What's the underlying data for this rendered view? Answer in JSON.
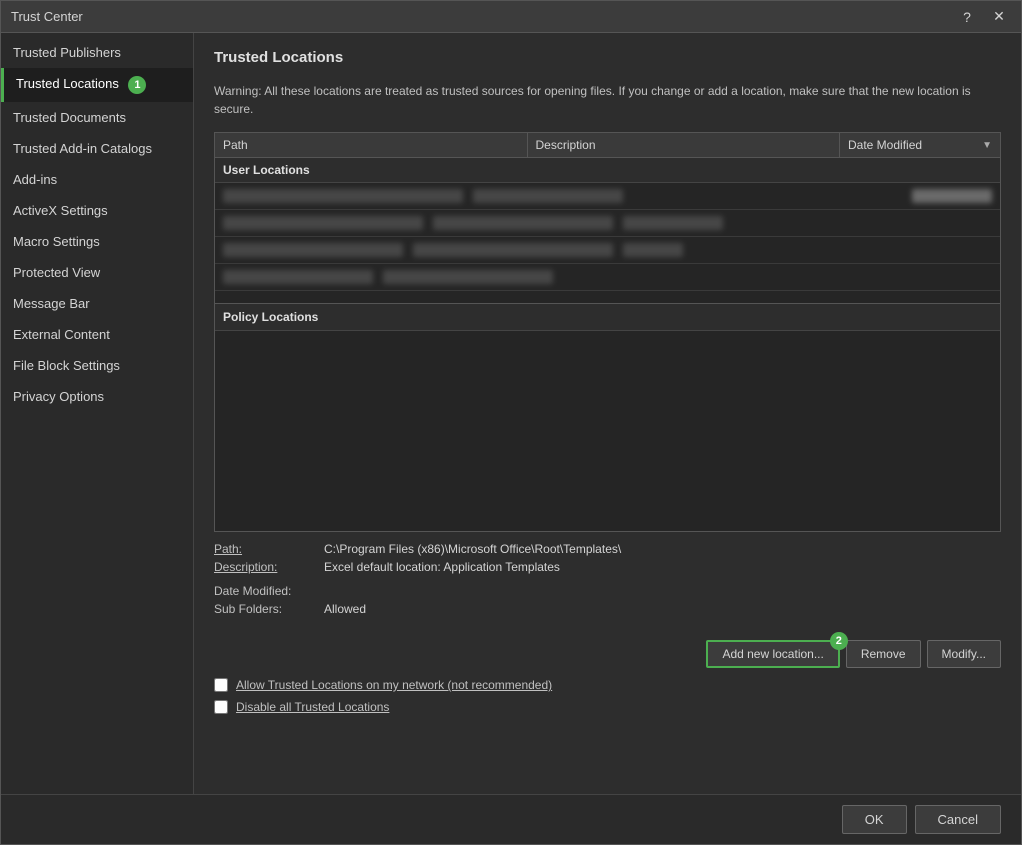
{
  "dialog": {
    "title": "Trust Center",
    "help_btn": "?",
    "close_btn": "✕"
  },
  "sidebar": {
    "items": [
      {
        "id": "trusted-publishers",
        "label": "Trusted Publishers",
        "active": false
      },
      {
        "id": "trusted-locations",
        "label": "Trusted Locations",
        "active": true,
        "badge": "1"
      },
      {
        "id": "trusted-documents",
        "label": "Trusted Documents",
        "active": false
      },
      {
        "id": "trusted-add-in-catalogs",
        "label": "Trusted Add-in Catalogs",
        "active": false
      },
      {
        "id": "add-ins",
        "label": "Add-ins",
        "active": false
      },
      {
        "id": "activex-settings",
        "label": "ActiveX Settings",
        "active": false
      },
      {
        "id": "macro-settings",
        "label": "Macro Settings",
        "active": false
      },
      {
        "id": "protected-view",
        "label": "Protected View",
        "active": false
      },
      {
        "id": "message-bar",
        "label": "Message Bar",
        "active": false
      },
      {
        "id": "external-content",
        "label": "External Content",
        "active": false
      },
      {
        "id": "file-block-settings",
        "label": "File Block Settings",
        "active": false
      },
      {
        "id": "privacy-options",
        "label": "Privacy Options",
        "active": false
      }
    ]
  },
  "main": {
    "section_title": "Trusted Locations",
    "warning_text": "Warning: All these locations are treated as trusted sources for opening files.  If you change or add a location, make sure that the new location is secure.",
    "table": {
      "col_path": "Path",
      "col_description": "Description",
      "col_date_modified": "Date Modified",
      "user_locations_label": "User Locations",
      "policy_locations_label": "Policy Locations"
    },
    "details": {
      "path_label": "Path:",
      "path_value": "C:\\Program Files (x86)\\Microsoft Office\\Root\\Templates\\",
      "description_label": "Description:",
      "description_value": "Excel default location: Application Templates",
      "date_modified_label": "Date Modified:",
      "date_modified_value": "",
      "sub_folders_label": "Sub Folders:",
      "sub_folders_value": "Allowed"
    },
    "buttons": {
      "add_new_location": "Add new location...",
      "add_new_badge": "2",
      "remove": "Remove",
      "modify": "Modify..."
    },
    "checkboxes": {
      "allow_network": "Allow Trusted Locations on my network (not recommended)",
      "disable_all": "Disable all Trusted Locations"
    },
    "footer": {
      "ok": "OK",
      "cancel": "Cancel"
    }
  }
}
